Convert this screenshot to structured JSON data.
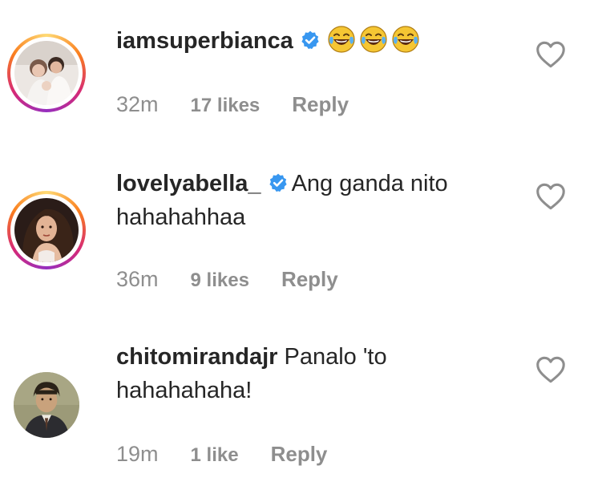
{
  "comments": [
    {
      "username": "iamsuperbianca",
      "verified": true,
      "text": "",
      "emojis": [
        "face-with-tears-of-joy",
        "face-with-tears-of-joy",
        "face-with-tears-of-joy"
      ],
      "time": "32m",
      "likes": "17 likes",
      "reply": "Reply",
      "story_ring": true
    },
    {
      "username": "lovelyabella_",
      "verified": true,
      "text": "Ang ganda nito hahahahhaa",
      "time": "36m",
      "likes": "9 likes",
      "reply": "Reply",
      "story_ring": true
    },
    {
      "username": "chitomirandajr",
      "verified": false,
      "text": "Panalo 'to hahahahaha!",
      "time": "19m",
      "likes": "1 like",
      "reply": "Reply",
      "story_ring": false
    }
  ],
  "icons": {
    "verified_badge": "verified-badge-icon",
    "like": "heart-outline-icon",
    "emoji": "face-with-tears-of-joy-emoji"
  },
  "colors": {
    "text": "#262626",
    "meta": "#8e8e8e",
    "verified": "#3897f0",
    "heart_outline": "#8e8e8e"
  }
}
